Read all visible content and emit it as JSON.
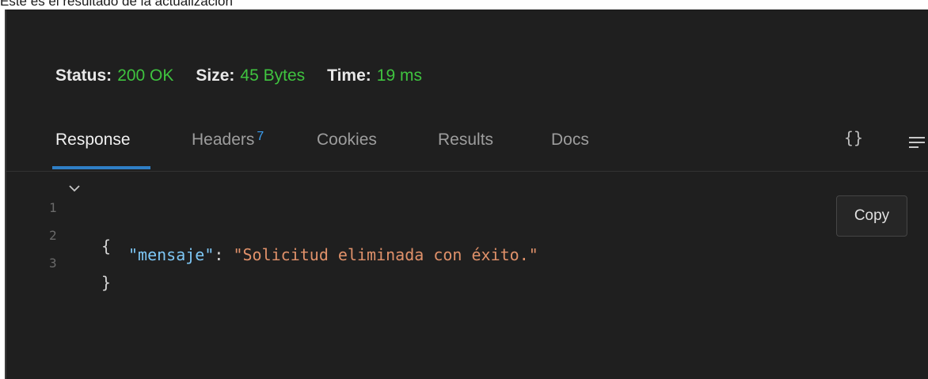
{
  "caption": "Este es el resultado de la actualización",
  "status": {
    "status_label": "Status:",
    "status_value": "200 OK",
    "size_label": "Size:",
    "size_value": "45 Bytes",
    "time_label": "Time:",
    "time_value": "19 ms"
  },
  "tabs": {
    "response": "Response",
    "headers": "Headers",
    "headers_count": "7",
    "cookies": "Cookies",
    "results": "Results",
    "docs": "Docs",
    "active": "Response"
  },
  "toolbar": {
    "format_icon": "braces-icon",
    "braces_glyph": "{}",
    "wrap_icon": "wrap-lines-icon"
  },
  "editor": {
    "lines": [
      {
        "num": "1",
        "open_brace": "{"
      },
      {
        "num": "2",
        "key": "\"mensaje\"",
        "sep": ": ",
        "value": "\"Solicitud eliminada con éxito.\""
      },
      {
        "num": "3",
        "close_brace": "}"
      }
    ]
  },
  "copy_button": {
    "label": "Copy"
  },
  "colors": {
    "status_ok": "#3fc33f",
    "accent": "#2f7fc6",
    "json_key": "#7ec7f5",
    "json_string": "#e0916a",
    "panel_bg": "#1f1f1f"
  }
}
